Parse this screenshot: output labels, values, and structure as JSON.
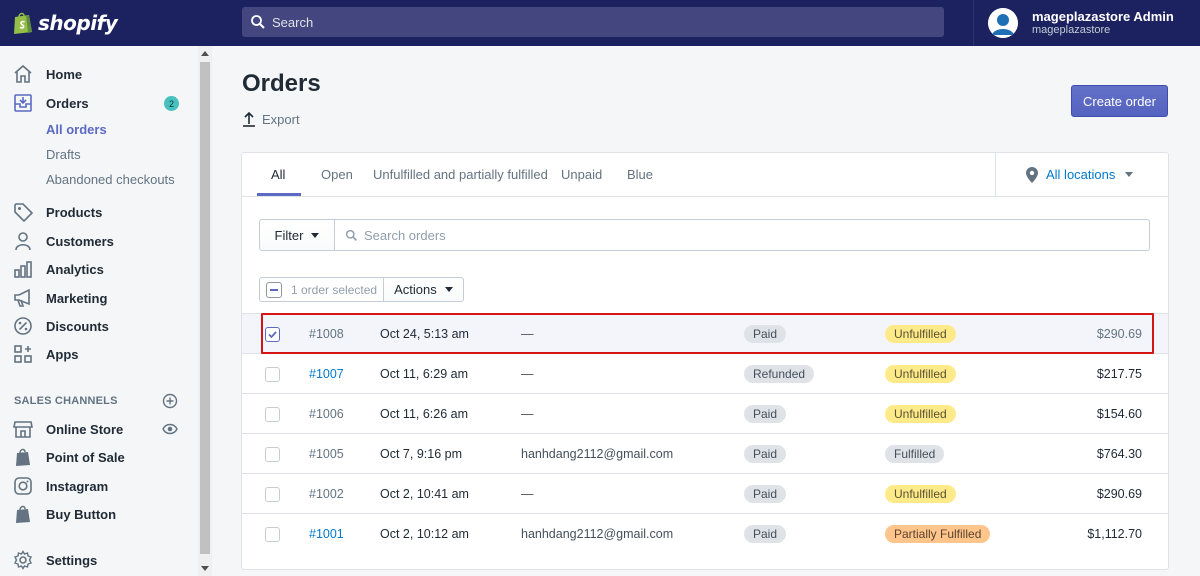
{
  "brand": {
    "name": "shopify"
  },
  "topbar": {
    "search_placeholder": "Search"
  },
  "user": {
    "name": "mageplazastore Admin",
    "store": "mageplazastore"
  },
  "sidebar": {
    "items": [
      {
        "label": "Home",
        "icon": "home-icon"
      },
      {
        "label": "Orders",
        "icon": "orders-icon",
        "badge": "2"
      },
      {
        "label": "Products",
        "icon": "tag-icon"
      },
      {
        "label": "Customers",
        "icon": "person-icon"
      },
      {
        "label": "Analytics",
        "icon": "bar-chart-icon"
      },
      {
        "label": "Marketing",
        "icon": "megaphone-icon"
      },
      {
        "label": "Discounts",
        "icon": "discount-icon"
      },
      {
        "label": "Apps",
        "icon": "apps-icon"
      }
    ],
    "orders_sub": [
      {
        "label": "All orders",
        "active": true
      },
      {
        "label": "Drafts"
      },
      {
        "label": "Abandoned checkouts"
      }
    ],
    "sales_channels_title": "SALES CHANNELS",
    "channels": [
      {
        "label": "Online Store",
        "icon": "store-icon"
      },
      {
        "label": "Point of Sale",
        "icon": "shopping-bag-icon"
      },
      {
        "label": "Instagram",
        "icon": "instagram-icon"
      },
      {
        "label": "Buy Button",
        "icon": "shopping-bag-icon"
      }
    ],
    "settings": {
      "label": "Settings",
      "icon": "gear-icon"
    }
  },
  "page": {
    "title": "Orders",
    "export_label": "Export",
    "create_label": "Create order"
  },
  "tabs": [
    "All",
    "Open",
    "Unfulfilled and partially fulfilled",
    "Unpaid",
    "Blue"
  ],
  "location_label": "All locations",
  "filter": {
    "label": "Filter",
    "search_placeholder": "Search orders"
  },
  "bulk": {
    "selected_label": "1 order selected",
    "actions_label": "Actions"
  },
  "orders": [
    {
      "id": "#1008",
      "date": "Oct 24, 5:13 am",
      "customer": "—",
      "payment": "Paid",
      "fulfillment": "Unfulfilled",
      "total": "$290.69",
      "selected": true
    },
    {
      "id": "#1007",
      "date": "Oct 11, 6:29 am",
      "customer": "—",
      "payment": "Refunded",
      "fulfillment": "Unfulfilled",
      "total": "$217.75"
    },
    {
      "id": "#1006",
      "date": "Oct 11, 6:26 am",
      "customer": "—",
      "payment": "Paid",
      "fulfillment": "Unfulfilled",
      "total": "$154.60"
    },
    {
      "id": "#1005",
      "date": "Oct 7, 9:16 pm",
      "customer": "hanhdang2112@gmail.com",
      "payment": "Paid",
      "fulfillment": "Fulfilled",
      "total": "$764.30"
    },
    {
      "id": "#1002",
      "date": "Oct 2, 10:41 am",
      "customer": "—",
      "payment": "Paid",
      "fulfillment": "Unfulfilled",
      "total": "$290.69"
    },
    {
      "id": "#1001",
      "date": "Oct 2, 10:12 am",
      "customer": "hanhdang2112@gmail.com",
      "payment": "Paid",
      "fulfillment": "Partially Fulfilled",
      "total": "$1,112.70"
    }
  ],
  "colors": {
    "topbar": "#1c2260",
    "accent": "#5c6ac4",
    "link": "#007ace",
    "highlight": "#d51515"
  }
}
